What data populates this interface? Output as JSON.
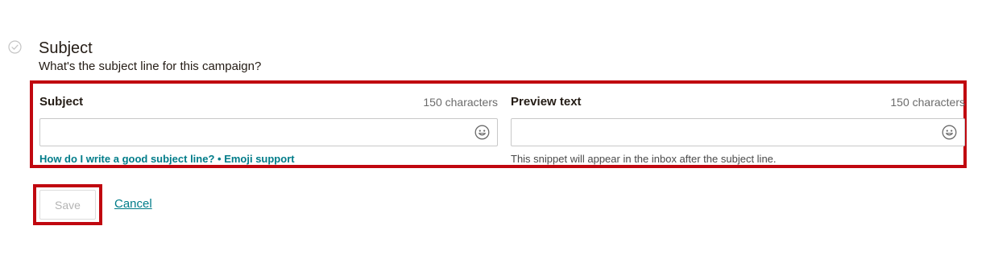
{
  "section": {
    "title": "Subject",
    "description": "What's the subject line for this campaign?",
    "status_icon": "check-circle-icon"
  },
  "subject_field": {
    "label": "Subject",
    "char_count": "150 characters",
    "value": "",
    "emoji_icon": "smiley-icon",
    "help_link": "How do I write a good subject line?",
    "separator": " • ",
    "emoji_link": "Emoji support"
  },
  "preview_field": {
    "label": "Preview text",
    "char_count": "150 characters",
    "value": "",
    "emoji_icon": "smiley-icon",
    "help_text": "This snippet will appear in the inbox after the subject line."
  },
  "actions": {
    "save_label": "Save",
    "cancel_label": "Cancel"
  },
  "colors": {
    "highlight": "#c0070f",
    "link": "#007c89",
    "text": "#241c15"
  }
}
